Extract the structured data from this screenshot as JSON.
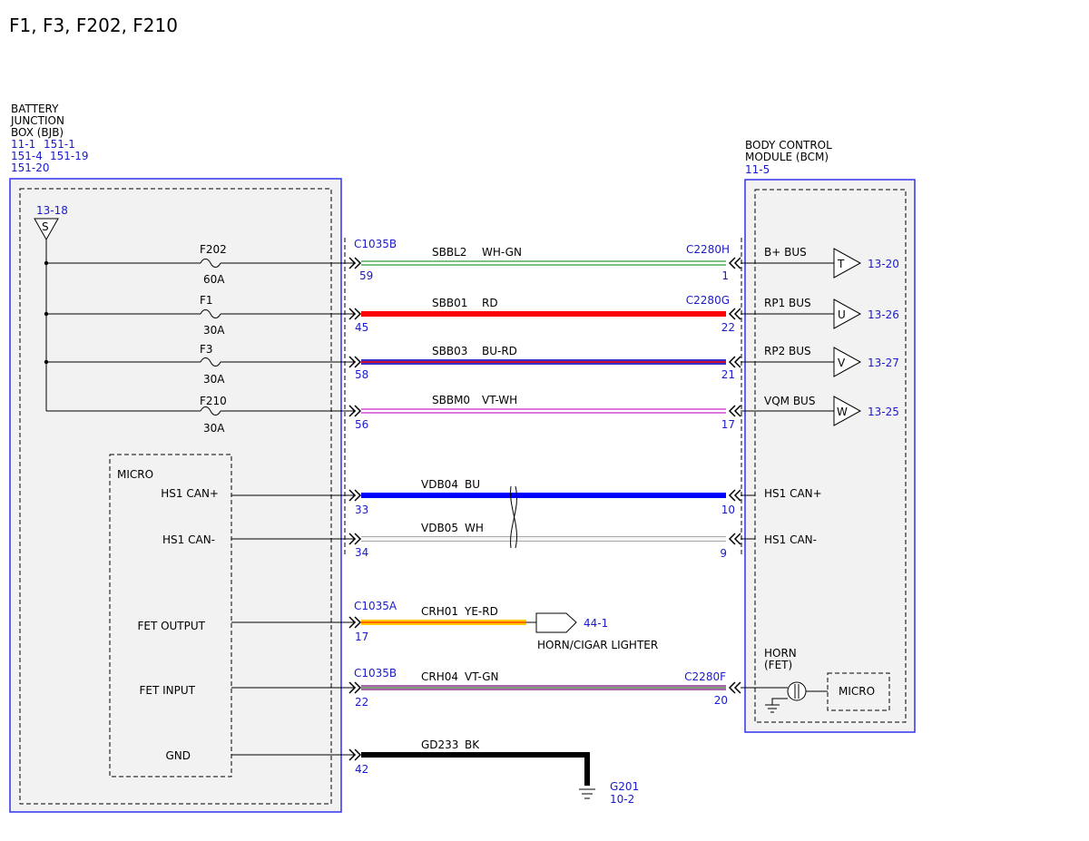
{
  "title": "F1, F3, F202, F210",
  "colors": {
    "frame": "#3333ee",
    "ref_text": "#1a1acc",
    "box_fill": "#f2f2f2",
    "wh_gn": [
      "#7bc47b",
      "#ffffff"
    ],
    "rd": [
      "#ff0000"
    ],
    "bu_rd": [
      "#3333cc",
      "#ff0000"
    ],
    "vt_wh": [
      "#dd77dd",
      "#ffffff"
    ],
    "bu": [
      "#0000ff"
    ],
    "wh": [
      "#f4f4f4",
      "#aaaaaa"
    ],
    "ye_rd": [
      "#ffcc00",
      "#ff0000"
    ],
    "vt_gn": [
      "#aa66aa",
      "#66bb66"
    ],
    "bk": [
      "#000000"
    ]
  },
  "bjb": {
    "label_lines": [
      "BATTERY",
      "JUNCTION",
      "BOX (BJB)"
    ],
    "refs": [
      "11-1",
      "151-1",
      "151-4",
      "151-19",
      "151-20"
    ],
    "splice_ref": "13-18",
    "splice_label": "S",
    "micro_label": "MICRO",
    "fuses": [
      {
        "name": "F202",
        "rating": "60A"
      },
      {
        "name": "F1",
        "rating": "30A"
      },
      {
        "name": "F3",
        "rating": "30A"
      },
      {
        "name": "F210",
        "rating": "30A"
      }
    ],
    "pins": [
      "HS1 CAN+",
      "HS1 CAN-",
      "FET OUTPUT",
      "FET INPUT",
      "GND"
    ]
  },
  "bcm": {
    "label_lines": [
      "BODY CONTROL",
      "MODULE (BCM)"
    ],
    "ref": "11-5",
    "horn_lines": [
      "HORN",
      "(FET)"
    ],
    "micro_label": "MICRO",
    "pins": [
      {
        "label": "B+ BUS",
        "letter": "T",
        "ref": "13-20"
      },
      {
        "label": "RP1 BUS",
        "letter": "U",
        "ref": "13-26"
      },
      {
        "label": "RP2 BUS",
        "letter": "V",
        "ref": "13-27"
      },
      {
        "label": "VQM BUS",
        "letter": "W",
        "ref": "13-25"
      },
      {
        "label": "HS1 CAN+"
      },
      {
        "label": "HS1 CAN-"
      }
    ]
  },
  "connectors": {
    "c1035b_top": "C1035B",
    "c1035a": "C1035A",
    "c1035b_bottom": "C1035B",
    "c2280h": "C2280H",
    "c2280g": "C2280G",
    "c2280f": "C2280F"
  },
  "circuits": [
    {
      "circuit": "SBBL2",
      "color": "WH-GN",
      "left_pin": "59",
      "right_pin": "1"
    },
    {
      "circuit": "SBB01",
      "color": "RD",
      "left_pin": "45",
      "right_pin": "22"
    },
    {
      "circuit": "SBB03",
      "color": "BU-RD",
      "left_pin": "58",
      "right_pin": "21"
    },
    {
      "circuit": "SBBM0",
      "color": "VT-WH",
      "left_pin": "56",
      "right_pin": "17"
    },
    {
      "circuit": "VDB04",
      "color": "BU",
      "left_pin": "33",
      "right_pin": "10"
    },
    {
      "circuit": "VDB05",
      "color": "WH",
      "left_pin": "34",
      "right_pin": "9"
    },
    {
      "circuit": "CRH01",
      "color": "YE-RD",
      "left_pin": "17"
    },
    {
      "circuit": "CRH04",
      "color": "VT-GN",
      "left_pin": "22",
      "right_pin": "20"
    },
    {
      "circuit": "GD233",
      "color": "BK",
      "left_pin": "42"
    }
  ],
  "horn_lighter": {
    "ref": "44-1",
    "label": "HORN/CIGAR LIGHTER"
  },
  "ground": {
    "name": "G201",
    "ref": "10-2"
  }
}
